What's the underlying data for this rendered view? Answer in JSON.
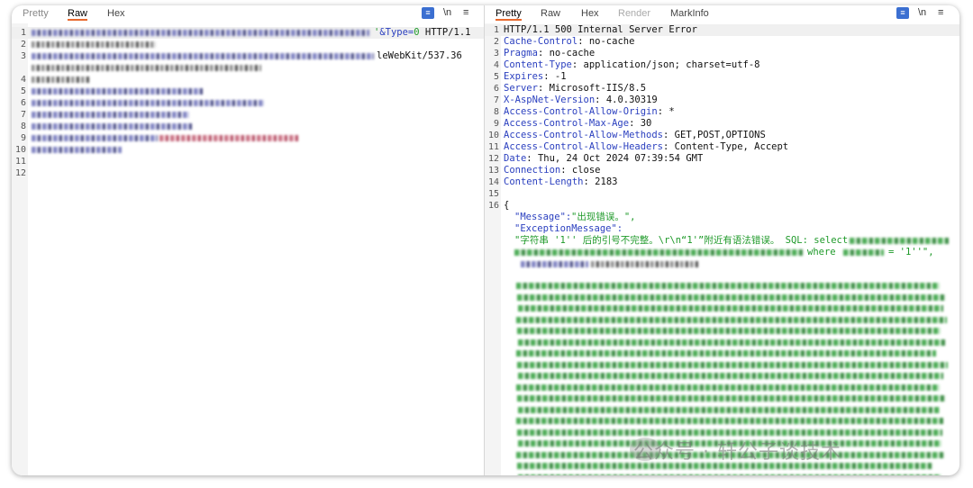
{
  "request": {
    "tabs": [
      "Pretty",
      "Raw",
      "Hex"
    ],
    "active_tab": "Raw",
    "tools": [
      "ln-icon",
      "newline-icon",
      "menu-icon"
    ],
    "line_numbers": [
      "1",
      "2",
      "3",
      "4",
      "5",
      "6",
      "7",
      "8",
      "9",
      "10",
      "11",
      "12"
    ],
    "line1_param": "&Type=0 HTTP/1.1",
    "line3_tail": "leWebKit/537.36"
  },
  "response": {
    "tabs": [
      "Pretty",
      "Raw",
      "Hex",
      "Render",
      "MarkInfo"
    ],
    "active_tab": "Pretty",
    "line_numbers": [
      "1",
      "2",
      "3",
      "4",
      "5",
      "6",
      "7",
      "8",
      "9",
      "10",
      "11",
      "12",
      "13",
      "14",
      "15",
      "16"
    ],
    "status_line": "HTTP/1.1 500 Internal Server Error",
    "headers": [
      {
        "name": "Cache-Control",
        "value": "no-cache"
      },
      {
        "name": "Pragma",
        "value": "no-cache"
      },
      {
        "name": "Content-Type",
        "value": "application/json; charset=utf-8"
      },
      {
        "name": "Expires",
        "value": "-1"
      },
      {
        "name": "Server",
        "value": "Microsoft-IIS/8.5"
      },
      {
        "name": "X-AspNet-Version",
        "value": "4.0.30319"
      },
      {
        "name": "Access-Control-Allow-Origin",
        "value": "*"
      },
      {
        "name": "Access-Control-Max-Age",
        "value": "30"
      },
      {
        "name": "Access-Control-Allow-Methods",
        "value": "GET,POST,OPTIONS"
      },
      {
        "name": "Access-Control-Allow-Headers",
        "value": "Content-Type, Accept"
      },
      {
        "name": "Date",
        "value": "Thu, 24 Oct 2024 07:39:54 GMT"
      },
      {
        "name": "Connection",
        "value": "close"
      },
      {
        "name": "Content-Length",
        "value": "2183"
      }
    ],
    "brace_open": "{",
    "message_key": "\"Message\":",
    "message_value": "\"出现错误。\",",
    "exception_key": "\"ExceptionMessage\":",
    "exception_value_start": "\"字符串 '1'' 后的引号不完整。\\r\\n“1'”附近有语法错误。 SQL: select",
    "exception_value_end": "where",
    "exception_value_tail": "= '1''\","
  },
  "watermark": "公众号 · 轩公子谈技术"
}
